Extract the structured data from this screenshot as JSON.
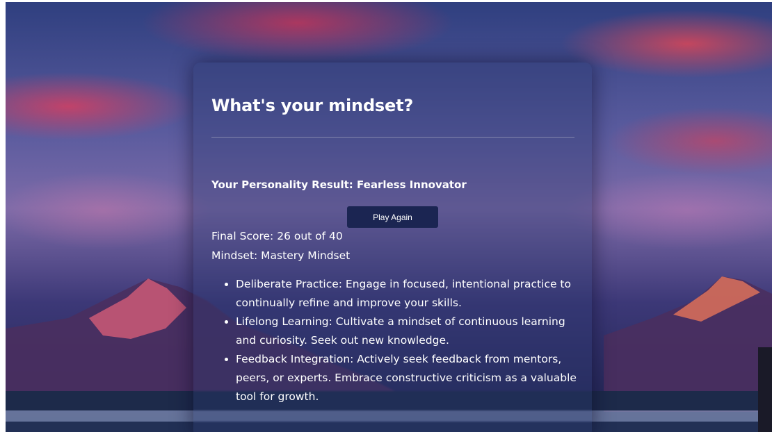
{
  "quiz": {
    "title": "What's your mindset?",
    "result_title": "Your Personality Result: Fearless Innovator",
    "play_again_label": "Play Again",
    "final_score": "Final Score: 26 out of 40",
    "mindset": "Mindset: Mastery Mindset",
    "tips": [
      "Deliberate Practice: Engage in focused, intentional practice to continually refine and improve your skills.",
      "Lifelong Learning: Cultivate a mindset of continuous learning and curiosity. Seek out new knowledge.",
      "Feedback Integration: Actively seek feedback from mentors, peers, or experts. Embrace constructive criticism as a valuable tool for growth."
    ]
  },
  "colors": {
    "button_bg": "#1b2552",
    "text": "#ffffff",
    "card_tint": "#28376e"
  }
}
